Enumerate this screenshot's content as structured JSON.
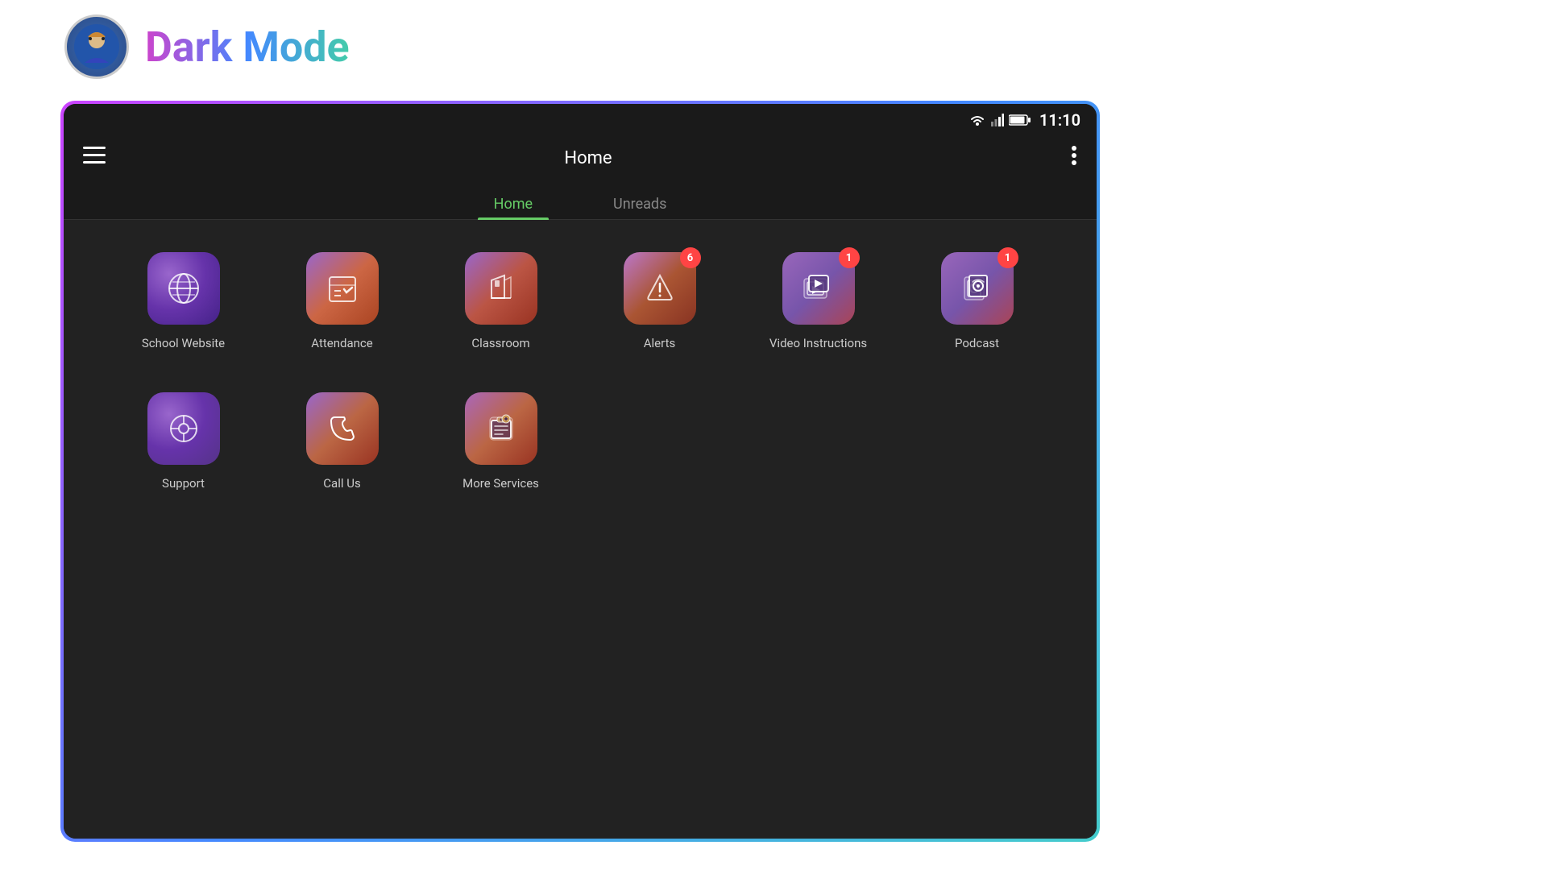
{
  "outer": {
    "title": "Dark Mode"
  },
  "statusBar": {
    "time": "11:10"
  },
  "appBar": {
    "title": "Home",
    "menuLabel": "≡",
    "moreLabel": "⋮"
  },
  "tabs": [
    {
      "id": "home",
      "label": "Home",
      "active": true
    },
    {
      "id": "unreads",
      "label": "Unreads",
      "active": false
    }
  ],
  "gridRow1": [
    {
      "id": "school-website",
      "label": "School Website",
      "badge": null,
      "iconColor": "school-website"
    },
    {
      "id": "attendance",
      "label": "Attendance",
      "badge": null,
      "iconColor": "attendance"
    },
    {
      "id": "classroom",
      "label": "Classroom",
      "badge": null,
      "iconColor": "classroom"
    },
    {
      "id": "alerts",
      "label": "Alerts",
      "badge": "6",
      "iconColor": "alerts"
    },
    {
      "id": "video-instructions",
      "label": "Video Instructions",
      "badge": "1",
      "iconColor": "video"
    },
    {
      "id": "podcast",
      "label": "Podcast",
      "badge": "1",
      "iconColor": "podcast"
    }
  ],
  "gridRow2": [
    {
      "id": "support",
      "label": "Support",
      "badge": null,
      "iconColor": "support"
    },
    {
      "id": "call-us",
      "label": "Call Us",
      "badge": null,
      "iconColor": "callus"
    },
    {
      "id": "more-services",
      "label": "More Services",
      "badge": null,
      "iconColor": "more"
    }
  ],
  "colors": {
    "activeTab": "#66cc66",
    "badge": "#ff4444",
    "bg": "#222222"
  }
}
